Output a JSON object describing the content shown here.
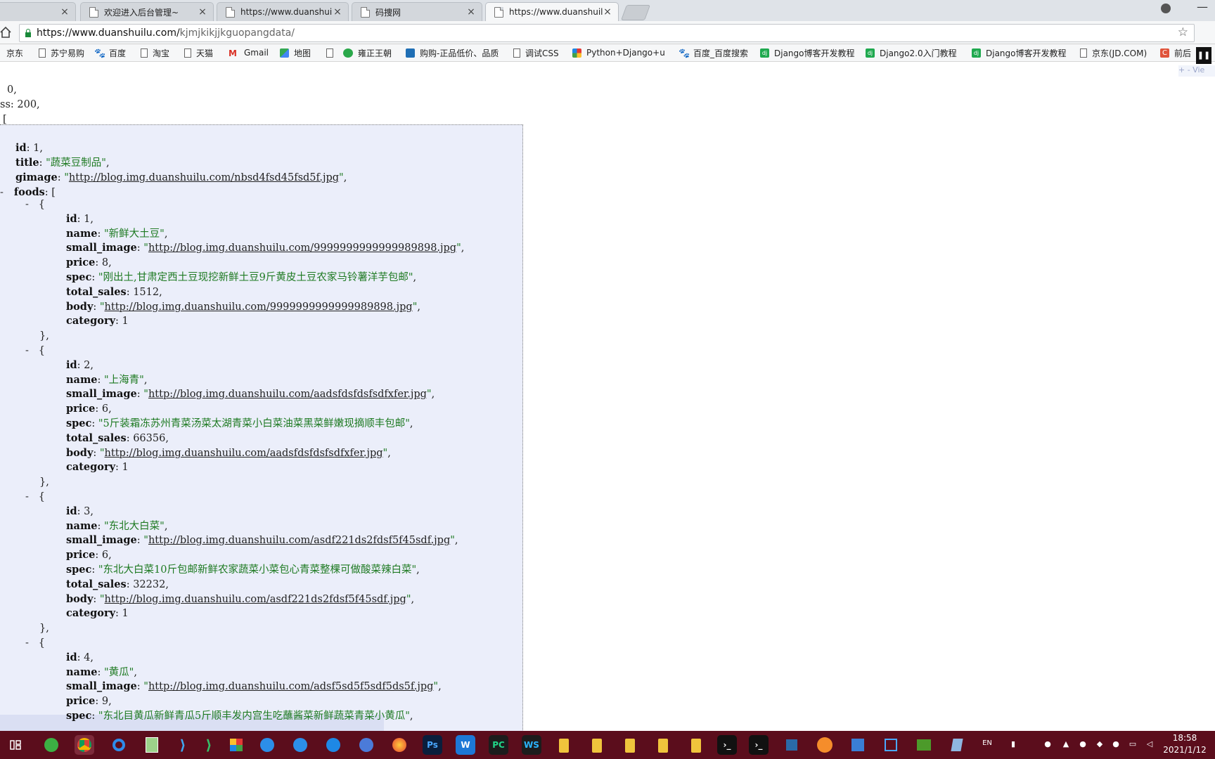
{
  "tabs": [
    {
      "title": "",
      "active": false
    },
    {
      "title": "欢迎进入后台管理~",
      "active": false
    },
    {
      "title": "https://www.duanshuil",
      "active": false
    },
    {
      "title": "码捜网",
      "active": false
    },
    {
      "title": "https://www.duanshuil",
      "active": true
    }
  ],
  "address": {
    "host": "https://www.duanshuilu.com/",
    "path": "kjmjkikjjkguopangdata/"
  },
  "bookmarks": [
    {
      "label": "京东",
      "icon": "none"
    },
    {
      "label": "苏宁易购",
      "icon": "page-icon"
    },
    {
      "label": "百度",
      "icon": "baidu-paw-icon"
    },
    {
      "label": "淘宝",
      "icon": "page-icon"
    },
    {
      "label": "天猫",
      "icon": "page-icon"
    },
    {
      "label": "Gmail",
      "icon": "gmail-icon"
    },
    {
      "label": "地图",
      "icon": "maps-icon"
    },
    {
      "label": "",
      "icon": "page-icon"
    },
    {
      "label": "雍正王朝",
      "icon": "play-icon"
    },
    {
      "label": "购购-正品低价、品质",
      "icon": "shop-icon"
    },
    {
      "label": "调试CSS",
      "icon": "page-icon"
    },
    {
      "label": "Python+Django+u",
      "icon": "colorful-app-icon"
    },
    {
      "label": "百度_百度搜索",
      "icon": "baidu-paw-icon"
    },
    {
      "label": "Django博客开发教程",
      "icon": "dj-icon"
    },
    {
      "label": "Django2.0入门教程",
      "icon": "dj-icon"
    },
    {
      "label": "Django博客开发教程",
      "icon": "dj-icon"
    },
    {
      "label": "京东(JD.COM)",
      "icon": "page-icon"
    },
    {
      "label": "前后",
      "icon": "c-icon"
    }
  ],
  "json_view": {
    "top_lines": [
      "0,",
      "ss: 200,",
      "["
    ],
    "category": {
      "id": "1",
      "title": "\"蔬菜豆制品\"",
      "gimage": "http://blog.img.duanshuilu.com/nbsd4fsd45fsd5f.jpg",
      "foods_label": "foods",
      "foods": [
        {
          "id": "1",
          "name": "\"新鲜大土豆\"",
          "small_image": "http://blog.img.duanshuilu.com/9999999999999989898.jpg",
          "price": "8",
          "spec": "\"刚出土,甘肃定西土豆现挖新鲜土豆9斤黄皮土豆农家马铃薯洋芋包邮\"",
          "total_sales": "1512",
          "body": "http://blog.img.duanshuilu.com/9999999999999989898.jpg",
          "category": "1"
        },
        {
          "id": "2",
          "name": "\"上海青\"",
          "small_image": "http://blog.img.duanshuilu.com/aadsfdsfdsfsdfxfer.jpg",
          "price": "6",
          "spec": "\"5斤装霜冻苏州青菜汤菜太湖青菜小白菜油菜黑菜鲜嫩现摘顺丰包邮\"",
          "total_sales": "66356",
          "body": "http://blog.img.duanshuilu.com/aadsfdsfdsfsdfxfer.jpg",
          "category": "1"
        },
        {
          "id": "3",
          "name": "\"东北大白菜\"",
          "small_image": "http://blog.img.duanshuilu.com/asdf221ds2fdsf5f45sdf.jpg",
          "price": "6",
          "spec": "\"东北大白菜10斤包邮新鲜农家蔬菜小菜包心青菜整棵可做酸菜辣白菜\"",
          "total_sales": "32232",
          "body": "http://blog.img.duanshuilu.com/asdf221ds2fdsf5f45sdf.jpg",
          "category": "1"
        },
        {
          "id": "4",
          "name": "\"黄瓜\"",
          "small_image": "http://blog.img.duanshuilu.com/adsf5sd5f5sdf5ds5f.jpg",
          "price": "9",
          "spec": "\"东北目黄瓜新鲜青瓜5斤顺丰发内宫生吃蘸酱菜新鲜蔬菜青菜小黄瓜\""
        }
      ]
    }
  },
  "overlay": {
    "view_label": "+ - Vie"
  },
  "taskbar": {
    "items": [
      "task-view-icon",
      "qihoo-browser-icon",
      "chrome-icon",
      "qq-browser-icon",
      "notepad-icon",
      "vscode-icon",
      "vscode-green-icon",
      "app-grid-icon",
      "ie-icon",
      "ie-icon",
      "sogou-icon",
      "sogou-browser-icon",
      "firefox-icon",
      "photoshop-icon",
      "wps-icon",
      "pycharm-icon",
      "webstorm-icon"
    ],
    "ps_label": "Ps",
    "pc_label": "PC",
    "ws_label": "WS",
    "lang": "EN",
    "time": "18:58",
    "date": "2021/1/12"
  }
}
